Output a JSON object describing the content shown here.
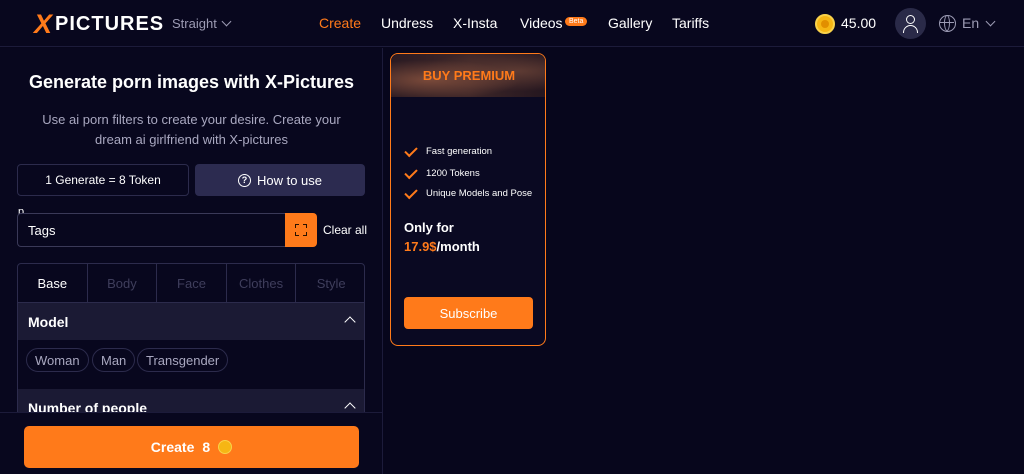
{
  "header": {
    "logo_x": "X",
    "logo_text": "PICTURES",
    "mode": "Straight",
    "nav": [
      {
        "label": "Create",
        "active": true
      },
      {
        "label": "Undress"
      },
      {
        "label": "X-Insta"
      },
      {
        "label": "Videos",
        "badge": "Beta"
      },
      {
        "label": "Gallery"
      },
      {
        "label": "Tariffs"
      }
    ],
    "balance": "45.00",
    "language": "En"
  },
  "generator": {
    "title": "Generate porn images with X-Pictures",
    "subtitle": "Use ai porn filters to create your desire. Create your dream ai girlfriend with X-pictures",
    "token_info": "1 Generate = 8 Token",
    "how_to_use": "How to use",
    "stray_text": "p",
    "tags_placeholder": "Tags",
    "clear_all": "Clear all",
    "tabs": [
      "Base",
      "Body",
      "Face",
      "Clothes",
      "Style"
    ],
    "sections": [
      {
        "title": "Model",
        "options": [
          "Woman",
          "Man",
          "Transgender"
        ]
      },
      {
        "title": "Number of people"
      }
    ],
    "create_label": "Create",
    "create_cost": "8"
  },
  "premium": {
    "title": "BUY PREMIUM",
    "features": [
      "Fast generation",
      "1200 Tokens",
      "Unique Models and Pose"
    ],
    "price_label": "Only for",
    "price_value": "17.9$",
    "price_period": "/month",
    "subscribe": "Subscribe"
  },
  "colors": {
    "accent": "#ff7a1a",
    "background": "#07061c",
    "panel": "#1b1a34"
  }
}
